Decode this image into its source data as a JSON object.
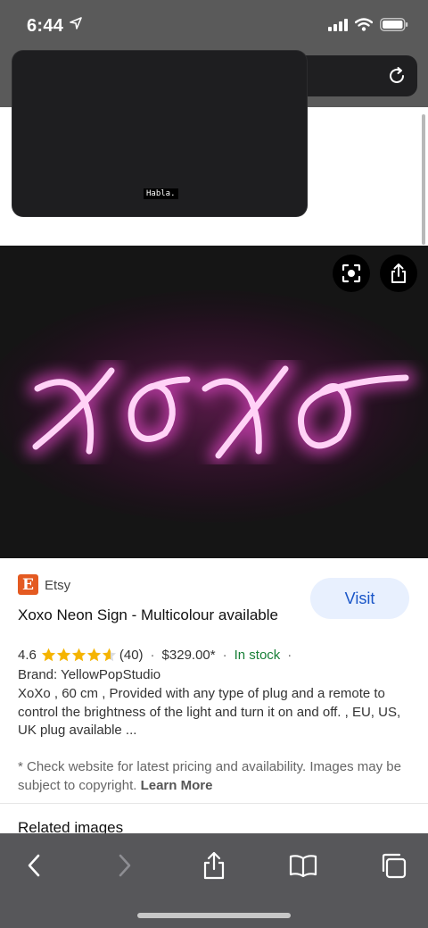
{
  "status": {
    "time": "6:44"
  },
  "popup": {
    "caption": "Habla."
  },
  "result": {
    "source": "Etsy",
    "source_logo_letter": "E",
    "visit_label": "Visit",
    "title": "Xoxo Neon Sign - Multicolour available",
    "rating": "4.6",
    "rating_count": "(40)",
    "price": "$329.00*",
    "stock": "In stock",
    "brand": "Brand: YellowPopStudio",
    "description": "XoXo , 60 cm , Provided with any type of plug and a remote to control the brightness of the light and turn it on and off. , EU, US, UK plug available ...",
    "disclaimer": "* Check website for latest pricing and availability. Images may be subject to copyright.",
    "learn_more": "Learn More",
    "related_heading": "Related images"
  },
  "icons": {
    "location": "location-arrow-icon",
    "signal": "signal-icon",
    "wifi": "wifi-icon",
    "battery": "battery-icon",
    "reload": "reload-icon",
    "lens": "lens-icon",
    "share": "share-icon",
    "back": "chevron-left-icon",
    "forward": "chevron-right-icon",
    "bookmarks": "book-icon",
    "tabs": "tabs-icon",
    "star": "star-icon"
  },
  "colors": {
    "neon": "#ff4fe0",
    "accent_blue": "#1a56c8",
    "in_stock_green": "#188038",
    "etsy_orange": "#e45a21"
  }
}
